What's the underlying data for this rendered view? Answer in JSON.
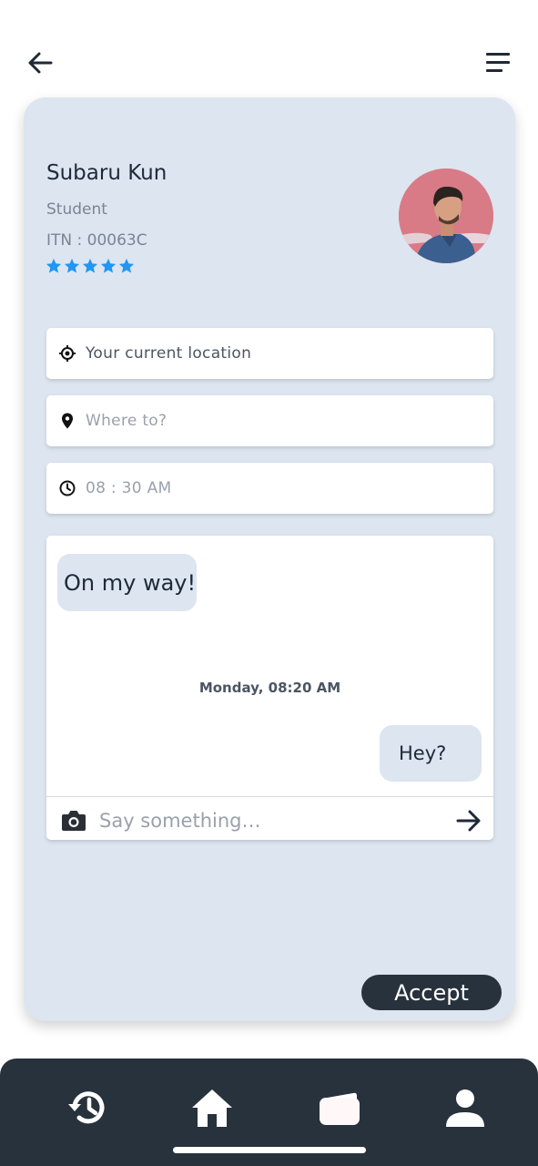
{
  "header": {
    "back_icon": "arrow-left-icon",
    "menu_icon": "hamburger-menu-icon"
  },
  "profile": {
    "name": "Subaru Kun",
    "role": "Student",
    "itn": "ITN : 00063C",
    "rating": 5,
    "star_color": "#2196f3",
    "avatar_icon": "profile-photo"
  },
  "trip": {
    "current_location": {
      "icon": "my-location-icon",
      "placeholder": "Your current location"
    },
    "destination": {
      "icon": "map-pin-icon",
      "placeholder": "Where to?"
    },
    "time": {
      "icon": "clock-icon",
      "placeholder": "08 : 30 AM"
    }
  },
  "chat": {
    "incoming": "On my way!",
    "date": "Monday, 08:20 AM",
    "outgoing": "Hey?",
    "input_placeholder": "Say something…",
    "camera_icon": "camera-icon",
    "send_icon": "arrow-right-icon"
  },
  "actions": {
    "accept_label": "Accept"
  },
  "bottom_nav": {
    "items": [
      {
        "icon": "history-icon"
      },
      {
        "icon": "home-icon"
      },
      {
        "icon": "wallet-icon"
      },
      {
        "icon": "person-icon"
      }
    ]
  },
  "colors": {
    "card_bg": "#dce5f0",
    "dark": "#27323c",
    "accent": "#2196f3"
  }
}
